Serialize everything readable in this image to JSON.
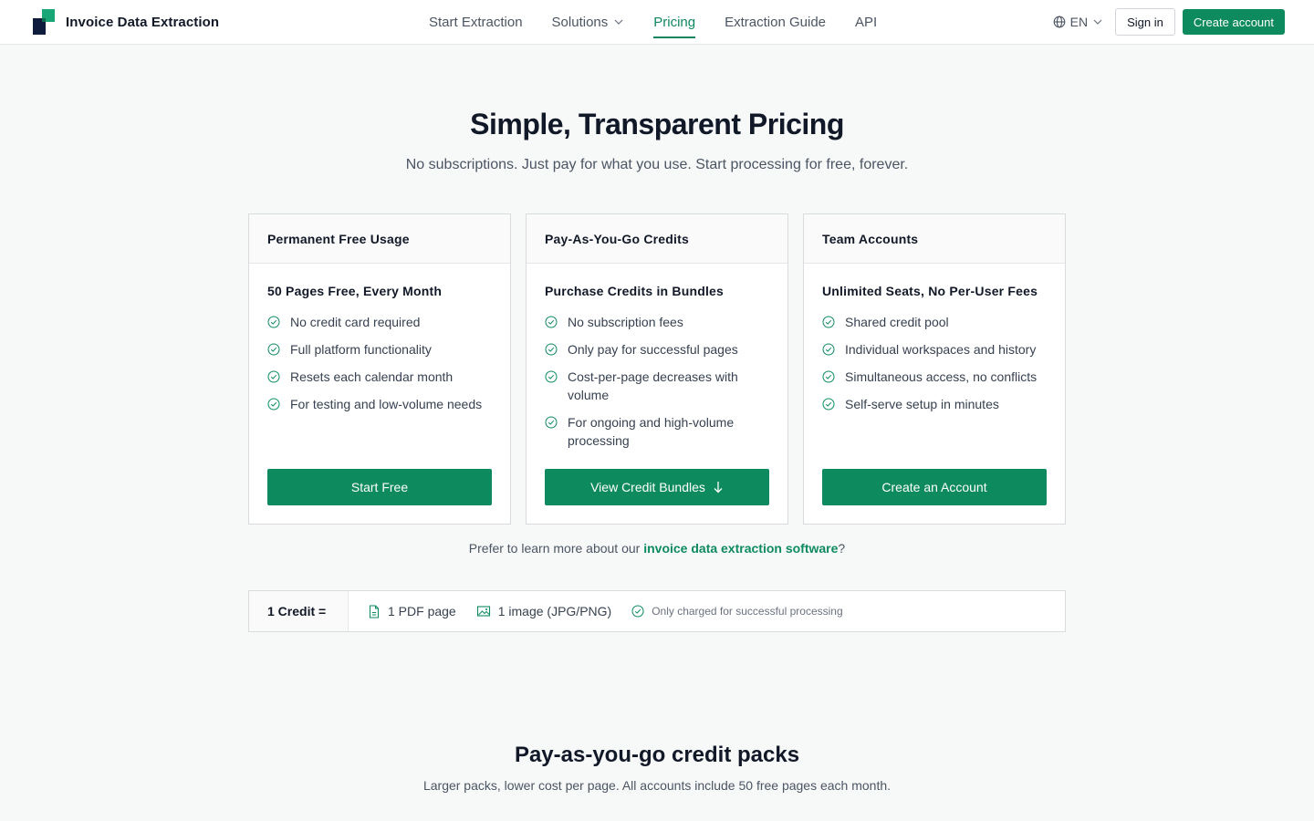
{
  "header": {
    "brand": "Invoice Data Extraction",
    "nav": [
      {
        "label": "Start Extraction",
        "active": false,
        "dropdown": false
      },
      {
        "label": "Solutions",
        "active": false,
        "dropdown": true
      },
      {
        "label": "Pricing",
        "active": true,
        "dropdown": false
      },
      {
        "label": "Extraction Guide",
        "active": false,
        "dropdown": false
      },
      {
        "label": "API",
        "active": false,
        "dropdown": false
      }
    ],
    "language": "EN",
    "signin_label": "Sign in",
    "create_label": "Create account"
  },
  "hero": {
    "title": "Simple, Transparent Pricing",
    "subtitle": "No subscriptions. Just pay for what you use. Start processing for free, forever."
  },
  "cards": [
    {
      "header": "Permanent Free Usage",
      "subtitle": "50 Pages Free, Every Month",
      "features": [
        "No credit card required",
        "Full platform functionality",
        "Resets each calendar month",
        "For testing and low-volume needs"
      ],
      "button": "Start Free",
      "button_icon": ""
    },
    {
      "header": "Pay-As-You-Go Credits",
      "subtitle": "Purchase Credits in Bundles",
      "features": [
        "No subscription fees",
        "Only pay for successful pages",
        "Cost-per-page decreases with volume",
        "For ongoing and high-volume processing"
      ],
      "button": "View Credit Bundles",
      "button_icon": "arrow-down-icon"
    },
    {
      "header": "Team Accounts",
      "subtitle": "Unlimited Seats, No Per-User Fees",
      "features": [
        "Shared credit pool",
        "Individual workspaces and history",
        "Simultaneous access, no conflicts",
        "Self-serve setup in minutes"
      ],
      "button": "Create an Account",
      "button_icon": ""
    }
  ],
  "learn_more": {
    "prefix": "Prefer to learn more about our ",
    "link": "invoice data extraction software",
    "suffix": "?"
  },
  "credit_strip": {
    "label": "1 Credit =",
    "items": [
      "1 PDF page",
      "1 image (JPG/PNG)",
      "Only charged for successful processing"
    ]
  },
  "packs": {
    "title": "Pay-as-you-go credit packs",
    "subtitle": "Larger packs, lower cost per page. All accounts include 50 free pages each month."
  },
  "colors": {
    "accent": "#0e8a5f",
    "dark": "#111827",
    "logo_navy": "#0f1b3d",
    "logo_green": "#1aa777"
  }
}
